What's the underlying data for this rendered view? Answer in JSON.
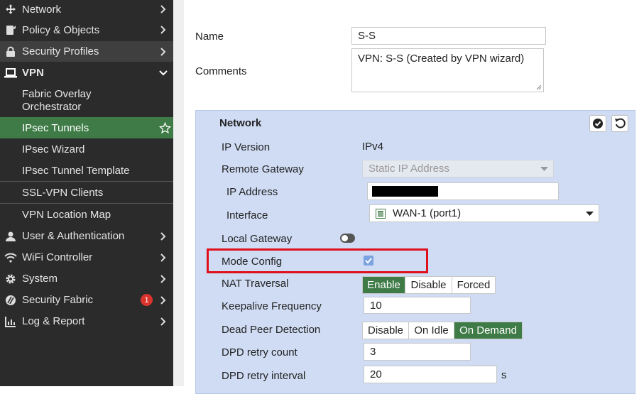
{
  "sidebar": {
    "items": [
      {
        "label": "Network",
        "icon": "move-arrows-icon"
      },
      {
        "label": "Policy & Objects",
        "icon": "policy-icon"
      },
      {
        "label": "Security Profiles",
        "icon": "lock-icon"
      },
      {
        "label": "VPN",
        "icon": "laptop-icon"
      }
    ],
    "vpn_children": [
      {
        "label": "Fabric Overlay",
        "label2": "Orchestrator"
      },
      {
        "label": "IPsec Tunnels"
      },
      {
        "label": "IPsec Wizard"
      },
      {
        "label": "IPsec Tunnel Template"
      },
      {
        "label": "SSL-VPN Clients"
      },
      {
        "label": "VPN Location Map"
      }
    ],
    "more": [
      {
        "label": "User & Authentication",
        "icon": "user-icon"
      },
      {
        "label": "WiFi Controller",
        "icon": "wifi-icon"
      },
      {
        "label": "System",
        "icon": "gear-icon"
      },
      {
        "label": "Security Fabric",
        "icon": "fabric-icon",
        "badge": "1"
      },
      {
        "label": "Log & Report",
        "icon": "chart-icon"
      }
    ]
  },
  "form": {
    "name_label": "Name",
    "name_value": "S-S",
    "comments_label": "Comments",
    "comments_value": "VPN: S-S (Created by VPN wizard)"
  },
  "network": {
    "title": "Network",
    "ip_version_label": "IP Version",
    "ip_version_value": "IPv4",
    "remote_gateway_label": "Remote Gateway",
    "remote_gateway_value": "Static IP Address",
    "ip_address_label": "IP Address",
    "interface_label": "Interface",
    "interface_value": "WAN-1 (port1)",
    "local_gateway_label": "Local Gateway",
    "mode_config_label": "Mode Config",
    "nat_traversal_label": "NAT Traversal",
    "nat_options": [
      "Enable",
      "Disable",
      "Forced"
    ],
    "keepalive_label": "Keepalive Frequency",
    "keepalive_value": "10",
    "dpd_label": "Dead Peer Detection",
    "dpd_options": [
      "Disable",
      "On Idle",
      "On Demand"
    ],
    "dpd_retry_count_label": "DPD retry count",
    "dpd_retry_count_value": "3",
    "dpd_retry_interval_label": "DPD retry interval",
    "dpd_retry_interval_value": "20",
    "dpd_retry_interval_unit": "s"
  },
  "colors": {
    "accent": "#3e7b46",
    "highlight": "#e0101a",
    "panel": "#cfdcf4",
    "sidebar": "#2b2b2b"
  }
}
